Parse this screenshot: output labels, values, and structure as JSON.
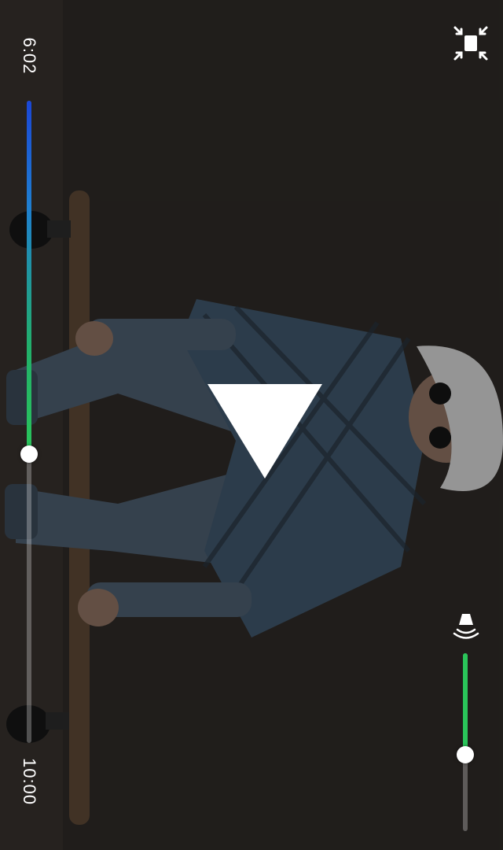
{
  "player": {
    "elapsed_time": "6:02",
    "total_time": "10:00",
    "progress_fraction": 0.55,
    "volume_fraction": 0.57,
    "state": "paused"
  },
  "icons": {
    "fullscreen": "exit-fullscreen-icon",
    "play": "play-icon",
    "volume": "speaker-icon"
  },
  "colors": {
    "progress_gradient_start": "#1a46d6",
    "progress_gradient_end": "#2ac55a",
    "volume_fill": "#2ac55a",
    "thumb": "#ffffff"
  }
}
